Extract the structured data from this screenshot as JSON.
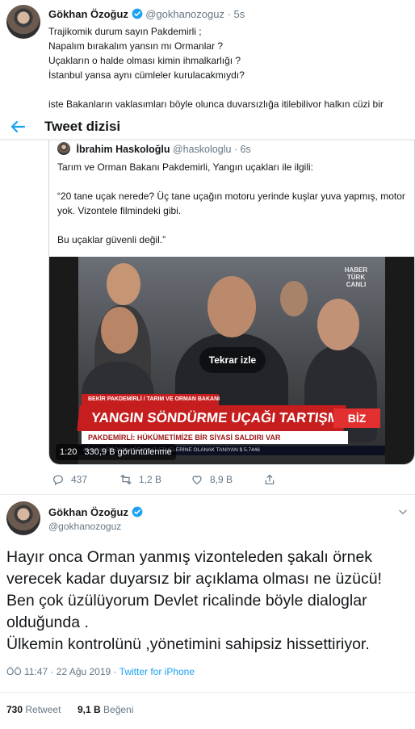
{
  "top_tweet": {
    "author_name": "Gökhan Özoğuz",
    "handle": "@gokhanozoguz",
    "time": "· 5s",
    "lines": [
      "Trajikomik durum sayın Pakdemirli ;",
      "Napalım bırakalım yansın mı Ormanlar ?",
      "Uçakların o halde olması kimin ihmalkarlığı ?",
      "İstanbul yansa aynı cümleler kurulacakmıydı?",
      "",
      "iste Bakanların vaklasımları böyle olunca duvarsızlığa itilebilivor halkın cüzi bir"
    ]
  },
  "thread_header": {
    "title": "Tweet dizisi"
  },
  "quoted_tweet": {
    "author_name": "İbrahim Haskoloğlu",
    "handle": "@haskologlu",
    "time": "· 6s",
    "paragraphs": [
      "Tarım ve Orman Bakanı Pakdemirli, Yangın uçakları ile ilgili:",
      "“20 tane uçak nerede? Üç tane uçağın motoru yerinde kuşlar yuva yapmış, motor yok. Vizontele filmindeki gibi.",
      "Bu uçaklar güvenli değil.”"
    ]
  },
  "video": {
    "logo": "HABER TÜRK CANLI",
    "nameplate": "BEKİR PAKDEMİRLİ / TARIM VE ORMAN BAKANI",
    "headline": "YANGIN SÖNDÜRME UÇAĞI TARTIŞMASI",
    "subline": "PAKDEMİRLİ: HÜKÜMETİMİZE BİR SİYASİ SALDIRI VAR",
    "corner_logo": "BİZ",
    "ticker": "ADAN YURT DIŞINA SEYAHAT ETMELERİNE OLANAK TANIYAN $ 5.7446",
    "replay_label": "Tekrar izle",
    "duration": "1:20",
    "views": "330,9 B görüntülenme"
  },
  "actions": {
    "reply_count": "437",
    "retweet_count": "1,2 B",
    "like_count": "8,9 B"
  },
  "main_tweet": {
    "author_name": "Gökhan Özoğuz",
    "handle": "@gokhanozoguz",
    "lines": [
      "Hayır onca Orman yanmış vizonteleden şakalı örnek",
      "verecek kadar duyarsız bir açıklama olması ne üzücü!",
      "Ben çok üzülüyorum Devlet ricalinde böyle dialoglar",
      "olduğunda .",
      "Ülkemin kontrolünü ,yönetimini sahipsiz hissettiriyor."
    ],
    "timestamp": "ÖÖ 11:47 · 22 Ağu 2019 · ",
    "source": "Twitter for iPhone",
    "retweets_value": "730",
    "retweets_label": "Retweet",
    "likes_value": "9,1 B",
    "likes_label": "Beğeni"
  },
  "colors": {
    "accent": "#1da1f2",
    "muted": "#657786",
    "border": "#e6ecf0",
    "breaking_red": "#c61e1e"
  }
}
